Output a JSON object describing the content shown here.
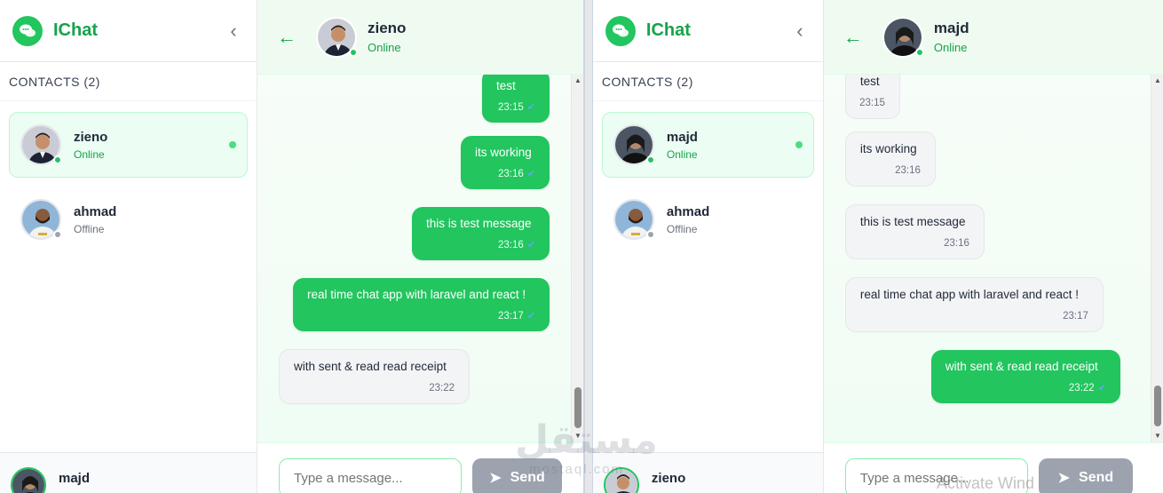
{
  "left": {
    "brand": "IChat",
    "contacts_label": "CONTACTS (2)",
    "contacts": [
      {
        "name": "zieno",
        "status": "Online",
        "online": true,
        "active": true
      },
      {
        "name": "ahmad",
        "status": "Offline",
        "online": false,
        "active": false
      }
    ],
    "me": {
      "name": "majd"
    },
    "chat": {
      "name": "zieno",
      "status": "Online",
      "messages": [
        {
          "text": "test",
          "time": "23:15",
          "dir": "out"
        },
        {
          "text": "its working",
          "time": "23:16",
          "dir": "out"
        },
        {
          "text": "this is test message",
          "time": "23:16",
          "dir": "out"
        },
        {
          "text": "real time chat app with laravel and react !",
          "time": "23:17",
          "dir": "out"
        },
        {
          "text": "with sent & read read receipt",
          "time": "23:22",
          "dir": "in"
        }
      ],
      "placeholder": "Type a message...",
      "send_label": "Send"
    }
  },
  "right": {
    "brand": "IChat",
    "contacts_label": "CONTACTS (2)",
    "contacts": [
      {
        "name": "majd",
        "status": "Online",
        "online": true,
        "active": true
      },
      {
        "name": "ahmad",
        "status": "Offline",
        "online": false,
        "active": false
      }
    ],
    "me": {
      "name": "zieno"
    },
    "chat": {
      "name": "majd",
      "status": "Online",
      "messages": [
        {
          "text": "test",
          "time": "23:15",
          "dir": "in"
        },
        {
          "text": "its working",
          "time": "23:16",
          "dir": "in"
        },
        {
          "text": "this is test message",
          "time": "23:16",
          "dir": "in"
        },
        {
          "text": "real time chat app with laravel and react !",
          "time": "23:17",
          "dir": "in"
        },
        {
          "text": "with sent & read read receipt",
          "time": "23:22",
          "dir": "out"
        }
      ],
      "placeholder": "Type a message...",
      "send_label": "Send"
    }
  },
  "icons": {
    "brand": "chat-bubbles-icon",
    "collapse": "chevron-left-icon",
    "back": "arrow-left-icon",
    "send": "paper-plane-icon",
    "read": "double-check-icon"
  },
  "colors": {
    "accent": "#22c55e",
    "accent_dark": "#16a34a",
    "incoming": "#f3f4f6",
    "send_disabled": "#9ca3af",
    "read_tick": "#60a5fa"
  },
  "overlay": {
    "watermark": "مستقل",
    "watermark_sub": "mostaql.com",
    "os_notice": "Activate Wind"
  }
}
